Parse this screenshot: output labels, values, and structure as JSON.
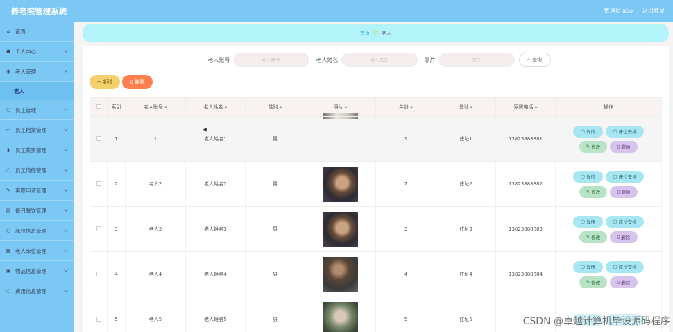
{
  "app": {
    "title": "养老院管理系统"
  },
  "header": {
    "user_label": "管理员 abo",
    "logout_label": "退出登录"
  },
  "sidebar": {
    "items": [
      {
        "label": "首页",
        "icon": "home-icon"
      },
      {
        "label": "个人中心",
        "icon": "user-icon"
      },
      {
        "label": "老人管理",
        "icon": "location-icon",
        "open": true,
        "sub": [
          {
            "label": "老人"
          }
        ]
      },
      {
        "label": "员工管理",
        "icon": "circle-icon"
      },
      {
        "label": "员工档案管理",
        "icon": "folder-icon"
      },
      {
        "label": "员工薪资管理",
        "icon": "bar-chart-icon"
      },
      {
        "label": "员工请假管理",
        "icon": "circle-icon"
      },
      {
        "label": "离职申请管理",
        "icon": "edit-icon"
      },
      {
        "label": "每日餐饮管理",
        "icon": "document-icon"
      },
      {
        "label": "床位信息管理",
        "icon": "circle-icon"
      },
      {
        "label": "老人床位管理",
        "icon": "grid-icon"
      },
      {
        "label": "物品信息管理",
        "icon": "box-icon"
      },
      {
        "label": "费用信息管理",
        "icon": "circle-icon"
      }
    ]
  },
  "breadcrumb": {
    "home": "首页",
    "current": "老人"
  },
  "search": {
    "account_label": "老人账号",
    "account_placeholder": "老人账号",
    "name_label": "老人姓名",
    "name_placeholder": "老人姓名",
    "photo_label": "照片",
    "photo_placeholder": "照片",
    "button_label": "查询"
  },
  "toolbar": {
    "add_label": "新增",
    "delete_label": "删除"
  },
  "table": {
    "columns": [
      "索引",
      "老人账号",
      "老人姓名",
      "性别",
      "照片",
      "年龄",
      "住址",
      "家属电话",
      "操作"
    ],
    "rows": [
      {
        "index": "1",
        "account": "1",
        "name": "老人姓名1",
        "gender": "男",
        "age": "1",
        "address": "住址1",
        "phone": "13823888881"
      },
      {
        "index": "2",
        "account": "老人2",
        "name": "老人姓名2",
        "gender": "男",
        "age": "2",
        "address": "住址2",
        "phone": "13823888882"
      },
      {
        "index": "3",
        "account": "老人3",
        "name": "老人姓名3",
        "gender": "男",
        "age": "3",
        "address": "住址3",
        "phone": "13823888883"
      },
      {
        "index": "4",
        "account": "老人4",
        "name": "老人姓名4",
        "gender": "男",
        "age": "4",
        "address": "住址4",
        "phone": "13823888884"
      },
      {
        "index": "5",
        "account": "老人5",
        "name": "老人姓名5",
        "gender": "男",
        "age": "5",
        "address": "住址5",
        "phone": ""
      }
    ],
    "actions": {
      "detail": "详情",
      "bed": "床位安排",
      "edit": "修改",
      "remove": "删除"
    }
  },
  "watermark": "CSDN @卓越计算机毕设源码程序"
}
